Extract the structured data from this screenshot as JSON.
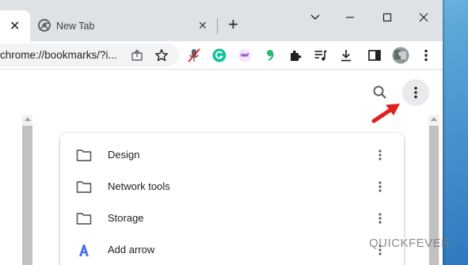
{
  "tabs": [
    {
      "label": "",
      "close": "✕"
    },
    {
      "label": "New Tab",
      "close": "✕"
    }
  ],
  "new_tab_symbol": "+",
  "window_controls": {
    "dropdown": "⌵",
    "minimize": "—",
    "maximize": "□",
    "close": "✕"
  },
  "address_bar": {
    "url": "chrome://bookmarks/?i..."
  },
  "bookmarks": [
    {
      "label": "Design",
      "icon": "folder-icon"
    },
    {
      "label": "Network tools",
      "icon": "folder-icon"
    },
    {
      "label": "Storage",
      "icon": "folder-icon"
    },
    {
      "label": "Add arrow",
      "icon": "add-arrow-favicon"
    }
  ],
  "watermark": "QUICKFEVER",
  "colors": {
    "accent_red": "#e02020",
    "favicon_blue": "#4a6cf7",
    "grammarly_green": "#15c39a",
    "purple_ext": "#9b4dca"
  }
}
